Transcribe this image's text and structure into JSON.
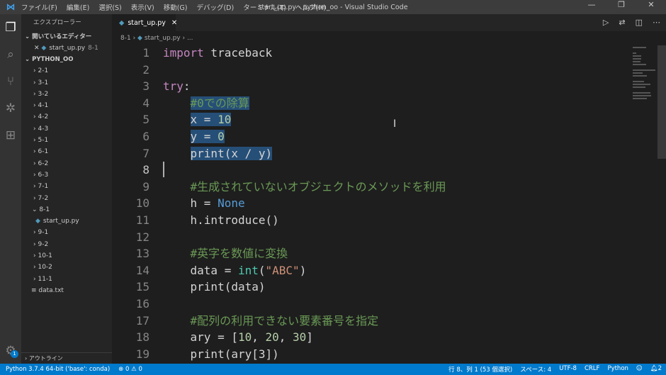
{
  "window": {
    "title": "start_up.py - python_oo - Visual Studio Code",
    "menu": [
      "ファイル(F)",
      "編集(E)",
      "選択(S)",
      "表示(V)",
      "移動(G)",
      "デバッグ(D)",
      "ターミナル(T)",
      "ヘルプ(H)"
    ]
  },
  "sidebar": {
    "header": "エクスプローラー",
    "open_editors": "開いているエディター",
    "open_file": {
      "name": "start_up.py",
      "folder": "8-1"
    },
    "project": "PYTHON_OO",
    "tree": [
      {
        "label": "2-1",
        "type": "folder"
      },
      {
        "label": "3-1",
        "type": "folder"
      },
      {
        "label": "3-2",
        "type": "folder"
      },
      {
        "label": "4-1",
        "type": "folder"
      },
      {
        "label": "4-2",
        "type": "folder"
      },
      {
        "label": "4-3",
        "type": "folder"
      },
      {
        "label": "5-1",
        "type": "folder"
      },
      {
        "label": "6-1",
        "type": "folder"
      },
      {
        "label": "6-2",
        "type": "folder"
      },
      {
        "label": "6-3",
        "type": "folder"
      },
      {
        "label": "7-1",
        "type": "folder"
      },
      {
        "label": "7-2",
        "type": "folder"
      },
      {
        "label": "8-1",
        "type": "open"
      },
      {
        "label": "start_up.py",
        "type": "pyfile"
      },
      {
        "label": "9-1",
        "type": "folder"
      },
      {
        "label": "9-2",
        "type": "folder"
      },
      {
        "label": "10-1",
        "type": "folder"
      },
      {
        "label": "10-2",
        "type": "folder"
      },
      {
        "label": "11-1",
        "type": "folder"
      },
      {
        "label": "data.txt",
        "type": "file"
      }
    ],
    "outline": "アウトライン",
    "settings_badge": "1"
  },
  "tab": {
    "label": "start_up.py"
  },
  "breadcrumb": {
    "folder": "8-1",
    "file": "start_up.py",
    "rest": "..."
  },
  "colors": {
    "keyword": "#c586c0",
    "comment": "#6a9955",
    "number": "#b5cea8",
    "string": "#ce9178",
    "constant": "#569cd6",
    "builtin": "#4ec9b0",
    "text": "#d4d4d4",
    "selection": "#264f78",
    "status": "#007acc"
  },
  "code": [
    [
      {
        "t": "import",
        "k": "keyword"
      },
      {
        "t": " traceback"
      }
    ],
    [],
    [
      {
        "t": "try",
        "k": "keyword"
      },
      {
        "t": ":"
      }
    ],
    [
      {
        "t": "    "
      },
      {
        "t": "#0での除算",
        "k": "comment",
        "sel": true
      }
    ],
    [
      {
        "t": "    "
      },
      {
        "t": "x = ",
        "sel": true
      },
      {
        "t": "10",
        "k": "number",
        "sel": true
      }
    ],
    [
      {
        "t": "    "
      },
      {
        "t": "y = ",
        "sel": true
      },
      {
        "t": "0",
        "k": "number",
        "sel": true
      }
    ],
    [
      {
        "t": "    "
      },
      {
        "t": "print(x / y)",
        "sel": true
      }
    ],
    [],
    [
      {
        "t": "    "
      },
      {
        "t": "#生成されていないオブジェクトのメソッドを利用",
        "k": "comment"
      }
    ],
    [
      {
        "t": "    h = "
      },
      {
        "t": "None",
        "k": "constant"
      }
    ],
    [
      {
        "t": "    h.introduce()"
      }
    ],
    [],
    [
      {
        "t": "    "
      },
      {
        "t": "#英字を数値に変換",
        "k": "comment"
      }
    ],
    [
      {
        "t": "    data = "
      },
      {
        "t": "int",
        "k": "builtin"
      },
      {
        "t": "("
      },
      {
        "t": "\"ABC\"",
        "k": "string"
      },
      {
        "t": ")"
      }
    ],
    [
      {
        "t": "    print(data)"
      }
    ],
    [],
    [
      {
        "t": "    "
      },
      {
        "t": "#配列の利用できない要素番号を指定",
        "k": "comment"
      }
    ],
    [
      {
        "t": "    ary = ["
      },
      {
        "t": "10",
        "k": "number"
      },
      {
        "t": ", "
      },
      {
        "t": "20",
        "k": "number"
      },
      {
        "t": ", "
      },
      {
        "t": "30",
        "k": "number"
      },
      {
        "t": "]"
      }
    ],
    [
      {
        "t": "    print(ary[3])"
      }
    ]
  ],
  "status": {
    "interpreter": "Python 3.7.4 64-bit ('base': conda)",
    "errors": "0",
    "warnings": "0",
    "position": "行 8、列 1 (53 個選択)",
    "spaces": "スペース: 4",
    "encoding": "UTF-8",
    "eol": "CRLF",
    "language": "Python",
    "notifications": "2"
  }
}
